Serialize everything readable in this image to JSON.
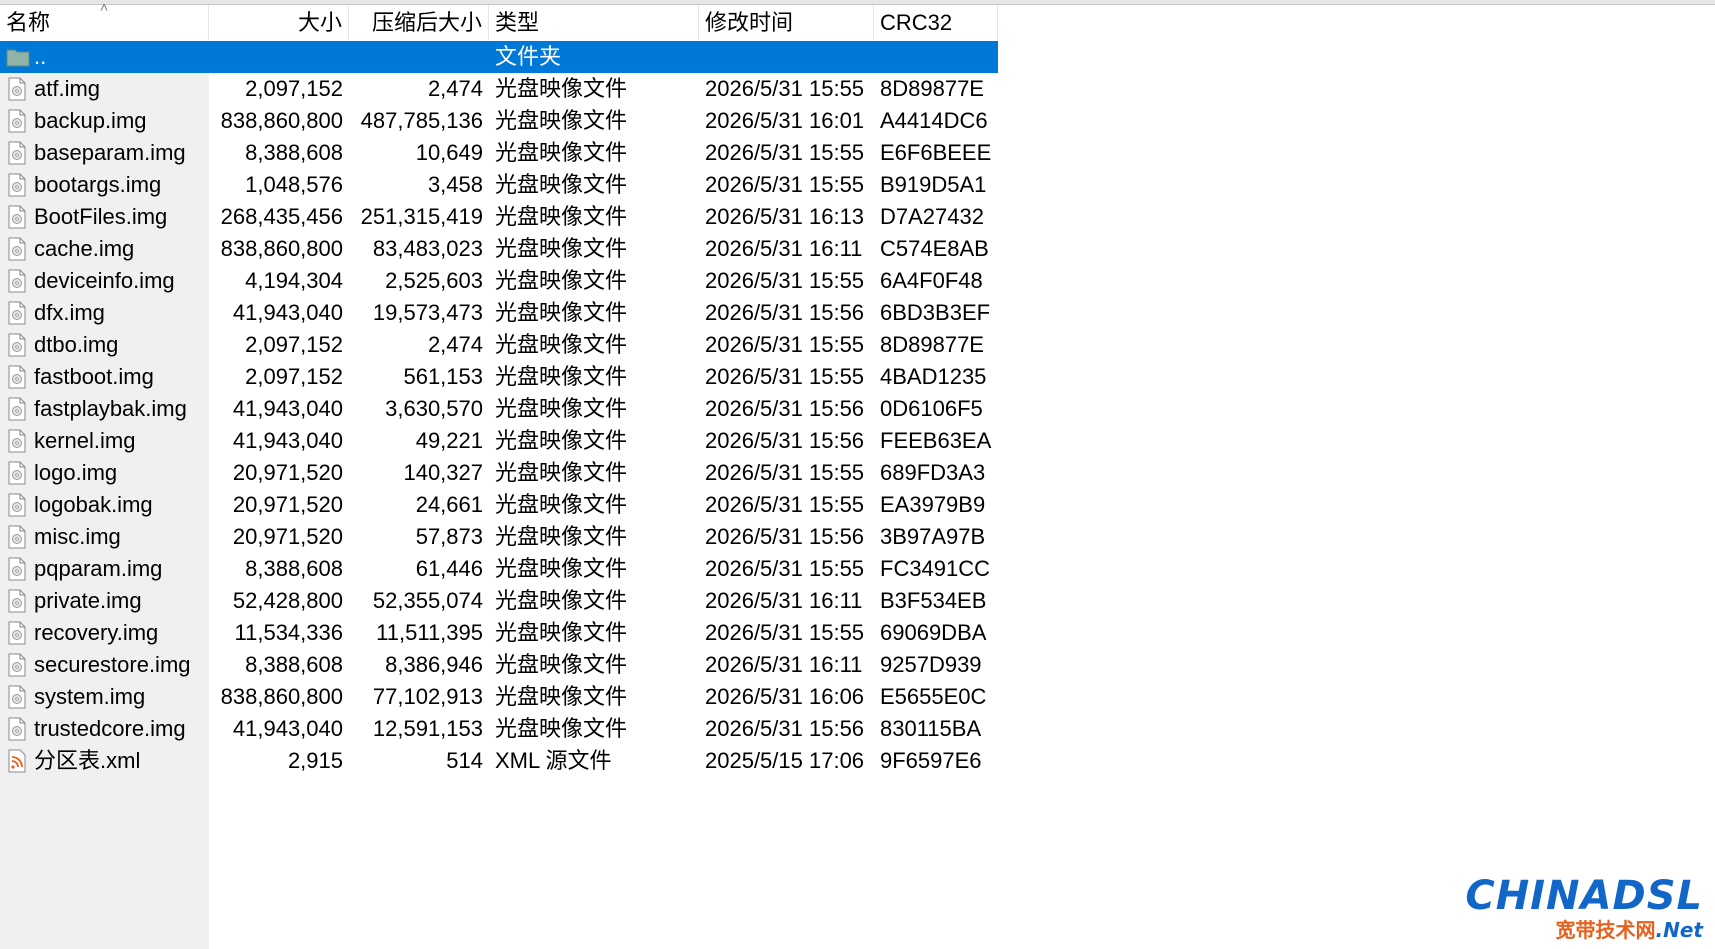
{
  "columns": {
    "name": "名称",
    "size": "大小",
    "compressed": "压缩后大小",
    "type": "类型",
    "modified": "修改时间",
    "crc": "CRC32"
  },
  "parent_row": {
    "name": "..",
    "type": "文件夹",
    "icon": "folder-icon"
  },
  "files": [
    {
      "name": "atf.img",
      "size": "2,097,152",
      "compressed": "2,474",
      "type": "光盘映像文件",
      "modified": "2026/5/31 15:55",
      "crc": "8D89877E",
      "icon": "disc-image-icon"
    },
    {
      "name": "backup.img",
      "size": "838,860,800",
      "compressed": "487,785,136",
      "type": "光盘映像文件",
      "modified": "2026/5/31 16:01",
      "crc": "A4414DC6",
      "icon": "disc-image-icon"
    },
    {
      "name": "baseparam.img",
      "size": "8,388,608",
      "compressed": "10,649",
      "type": "光盘映像文件",
      "modified": "2026/5/31 15:55",
      "crc": "E6F6BEEE",
      "icon": "disc-image-icon"
    },
    {
      "name": "bootargs.img",
      "size": "1,048,576",
      "compressed": "3,458",
      "type": "光盘映像文件",
      "modified": "2026/5/31 15:55",
      "crc": "B919D5A1",
      "icon": "disc-image-icon"
    },
    {
      "name": "BootFiles.img",
      "size": "268,435,456",
      "compressed": "251,315,419",
      "type": "光盘映像文件",
      "modified": "2026/5/31 16:13",
      "crc": "D7A27432",
      "icon": "disc-image-icon"
    },
    {
      "name": "cache.img",
      "size": "838,860,800",
      "compressed": "83,483,023",
      "type": "光盘映像文件",
      "modified": "2026/5/31 16:11",
      "crc": "C574E8AB",
      "icon": "disc-image-icon"
    },
    {
      "name": "deviceinfo.img",
      "size": "4,194,304",
      "compressed": "2,525,603",
      "type": "光盘映像文件",
      "modified": "2026/5/31 15:55",
      "crc": "6A4F0F48",
      "icon": "disc-image-icon"
    },
    {
      "name": "dfx.img",
      "size": "41,943,040",
      "compressed": "19,573,473",
      "type": "光盘映像文件",
      "modified": "2026/5/31 15:56",
      "crc": "6BD3B3EF",
      "icon": "disc-image-icon"
    },
    {
      "name": "dtbo.img",
      "size": "2,097,152",
      "compressed": "2,474",
      "type": "光盘映像文件",
      "modified": "2026/5/31 15:55",
      "crc": "8D89877E",
      "icon": "disc-image-icon"
    },
    {
      "name": "fastboot.img",
      "size": "2,097,152",
      "compressed": "561,153",
      "type": "光盘映像文件",
      "modified": "2026/5/31 15:55",
      "crc": "4BAD1235",
      "icon": "disc-image-icon"
    },
    {
      "name": "fastplaybak.img",
      "size": "41,943,040",
      "compressed": "3,630,570",
      "type": "光盘映像文件",
      "modified": "2026/5/31 15:56",
      "crc": "0D6106F5",
      "icon": "disc-image-icon"
    },
    {
      "name": "kernel.img",
      "size": "41,943,040",
      "compressed": "49,221",
      "type": "光盘映像文件",
      "modified": "2026/5/31 15:56",
      "crc": "FEEB63EA",
      "icon": "disc-image-icon"
    },
    {
      "name": "logo.img",
      "size": "20,971,520",
      "compressed": "140,327",
      "type": "光盘映像文件",
      "modified": "2026/5/31 15:55",
      "crc": "689FD3A3",
      "icon": "disc-image-icon"
    },
    {
      "name": "logobak.img",
      "size": "20,971,520",
      "compressed": "24,661",
      "type": "光盘映像文件",
      "modified": "2026/5/31 15:55",
      "crc": "EA3979B9",
      "icon": "disc-image-icon"
    },
    {
      "name": "misc.img",
      "size": "20,971,520",
      "compressed": "57,873",
      "type": "光盘映像文件",
      "modified": "2026/5/31 15:56",
      "crc": "3B97A97B",
      "icon": "disc-image-icon"
    },
    {
      "name": "pqparam.img",
      "size": "8,388,608",
      "compressed": "61,446",
      "type": "光盘映像文件",
      "modified": "2026/5/31 15:55",
      "crc": "FC3491CC",
      "icon": "disc-image-icon"
    },
    {
      "name": "private.img",
      "size": "52,428,800",
      "compressed": "52,355,074",
      "type": "光盘映像文件",
      "modified": "2026/5/31 16:11",
      "crc": "B3F534EB",
      "icon": "disc-image-icon"
    },
    {
      "name": "recovery.img",
      "size": "11,534,336",
      "compressed": "11,511,395",
      "type": "光盘映像文件",
      "modified": "2026/5/31 15:55",
      "crc": "69069DBA",
      "icon": "disc-image-icon"
    },
    {
      "name": "securestore.img",
      "size": "8,388,608",
      "compressed": "8,386,946",
      "type": "光盘映像文件",
      "modified": "2026/5/31 16:11",
      "crc": "9257D939",
      "icon": "disc-image-icon"
    },
    {
      "name": "system.img",
      "size": "838,860,800",
      "compressed": "77,102,913",
      "type": "光盘映像文件",
      "modified": "2026/5/31 16:06",
      "crc": "E5655E0C",
      "icon": "disc-image-icon"
    },
    {
      "name": "trustedcore.img",
      "size": "41,943,040",
      "compressed": "12,591,153",
      "type": "光盘映像文件",
      "modified": "2026/5/31 15:56",
      "crc": "830115BA",
      "icon": "disc-image-icon"
    },
    {
      "name": "分区表.xml",
      "size": "2,915",
      "compressed": "514",
      "type": "XML 源文件",
      "modified": "2025/5/15 17:06",
      "crc": "9F6597E6",
      "icon": "xml-feed-icon"
    }
  ],
  "watermark": {
    "top": "CHINADSL",
    "bottom_cn": "宽带技术网",
    "bottom_net": ".Net"
  },
  "colors": {
    "selection": "#0078d7",
    "name_column_bg": "#f0f0f0",
    "watermark_blue": "#1166c8",
    "watermark_orange": "#e8601c"
  }
}
